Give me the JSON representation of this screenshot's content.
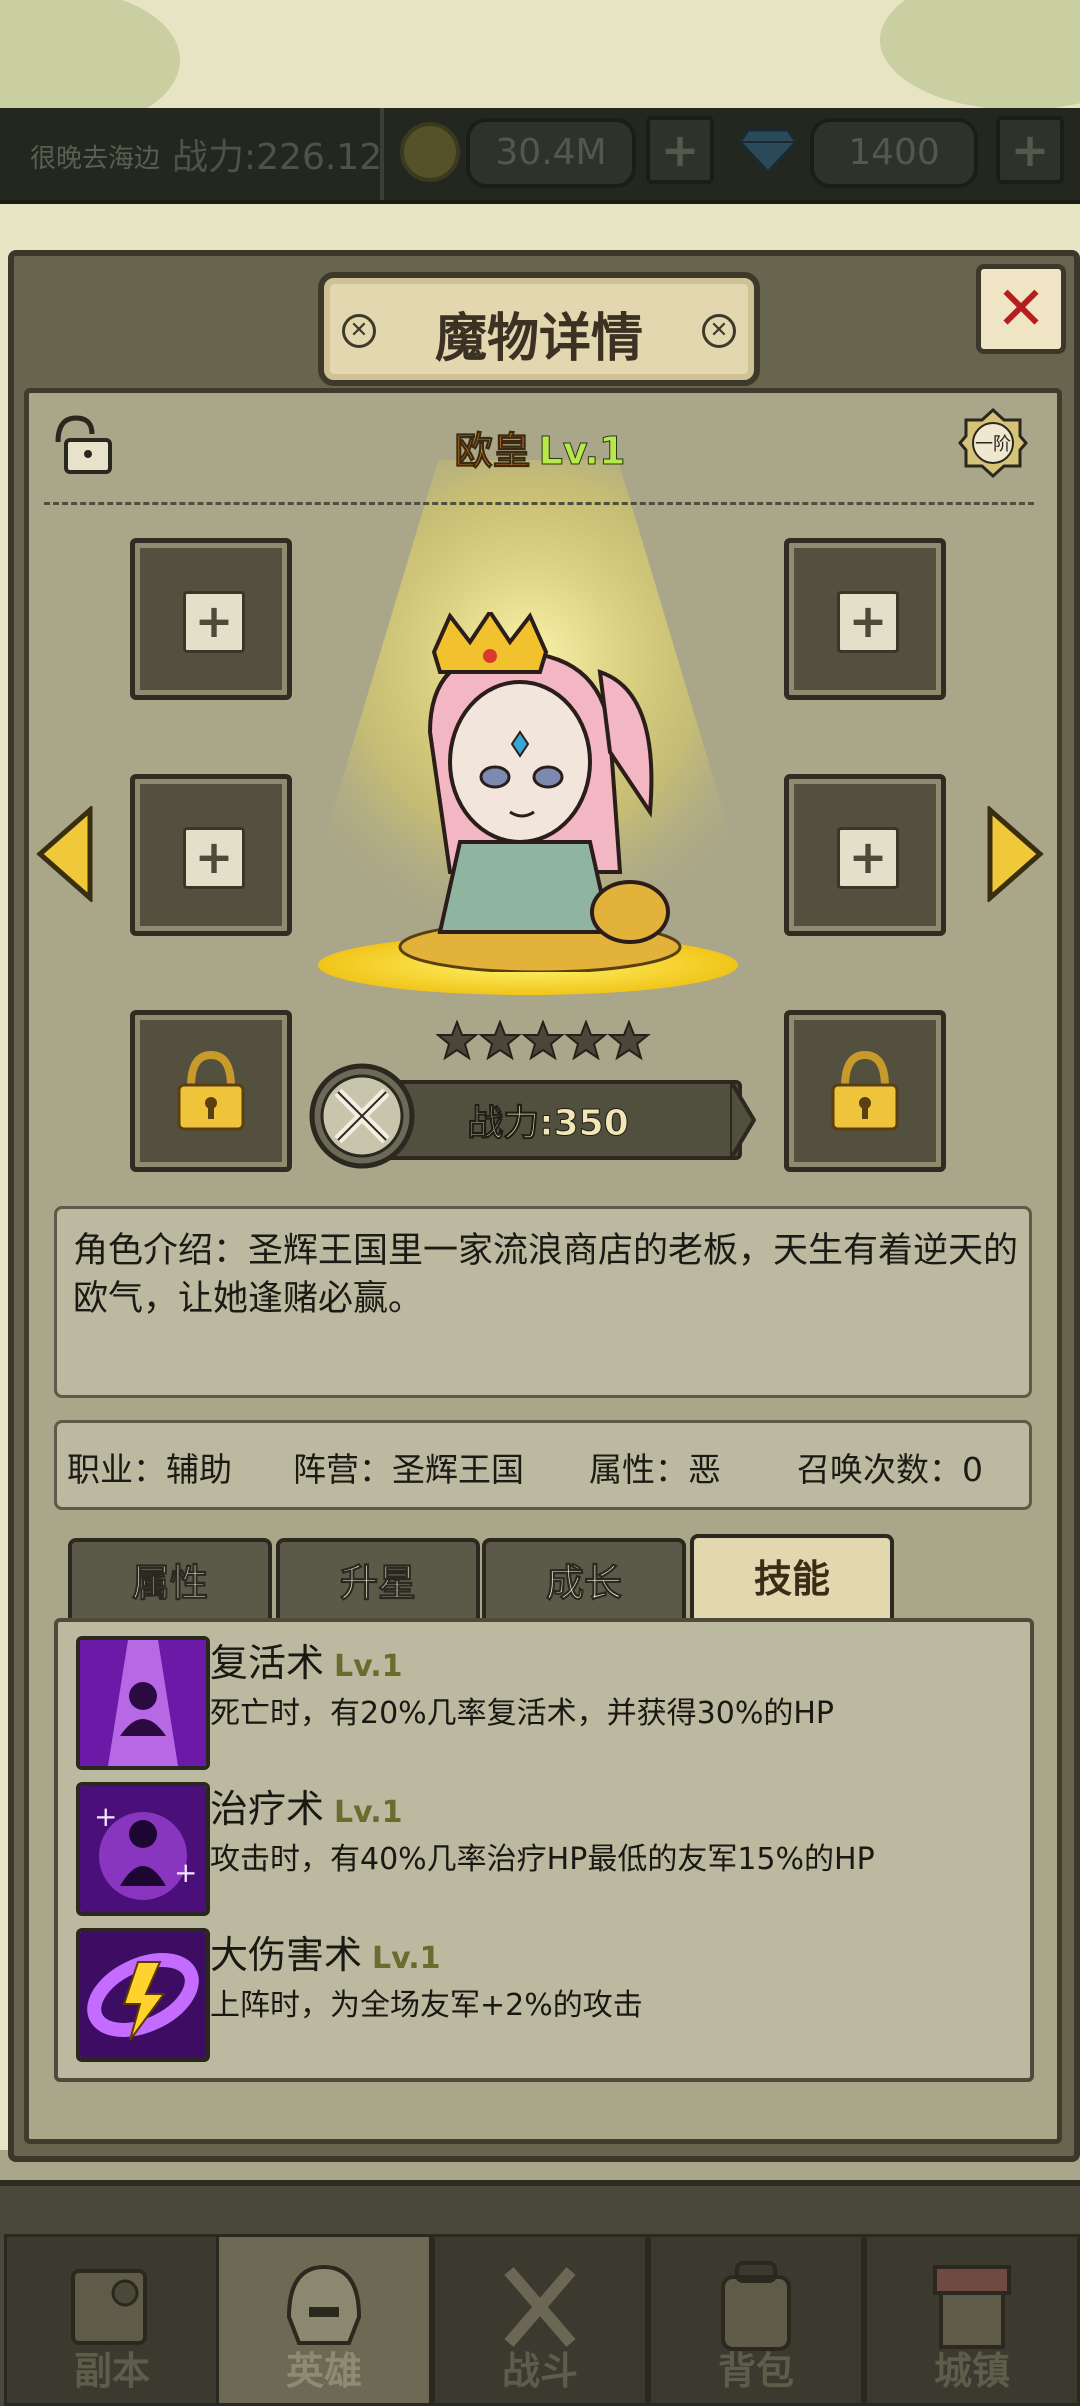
{
  "topbar": {
    "player_name": "很晚去海边",
    "power": "战力:226.12",
    "gold": "30.4M",
    "gems": "1400",
    "plus": "+"
  },
  "dialog": {
    "title": "魔物详情",
    "close": "✕",
    "hero_name": "欧皇",
    "hero_level": "Lv.1",
    "rank_badge": "一阶",
    "stars": 5,
    "power": "战力:350",
    "slot_plus": "+",
    "description": "角色介绍：圣辉王国里一家流浪商店的老板，天生有着逆天的欧气，让她逢赌必赢。",
    "info": {
      "role": "职业：辅助",
      "camp": "阵营：圣辉王国",
      "attribute": "属性：恶",
      "summons": "召唤次数：0"
    },
    "tabs": [
      "属性",
      "升星",
      "成长",
      "技能"
    ],
    "active_tab": "技能",
    "skills": [
      {
        "name": "复活术",
        "level": "Lv.1",
        "desc": "死亡时，有20%几率复活术，并获得30%的HP"
      },
      {
        "name": "治疗术",
        "level": "Lv.1",
        "desc": "攻击时，有40%几率治疗HP最低的友军15%的HP"
      },
      {
        "name": "大伤害术",
        "level": "Lv.1",
        "desc": "上阵时，为全场友军+2%的攻击"
      }
    ]
  },
  "nav": [
    {
      "label": "副本",
      "icon": "map-icon"
    },
    {
      "label": "英雄",
      "icon": "helmet-icon"
    },
    {
      "label": "战斗",
      "icon": "swords-icon"
    },
    {
      "label": "背包",
      "icon": "backpack-icon"
    },
    {
      "label": "城镇",
      "icon": "shop-icon"
    }
  ],
  "colors": {
    "panel": "#67654d",
    "inner": "#a9a68a",
    "accent_orange": "#f08a1c",
    "accent_green": "#b8e84c",
    "close_red": "#b51e1e"
  }
}
